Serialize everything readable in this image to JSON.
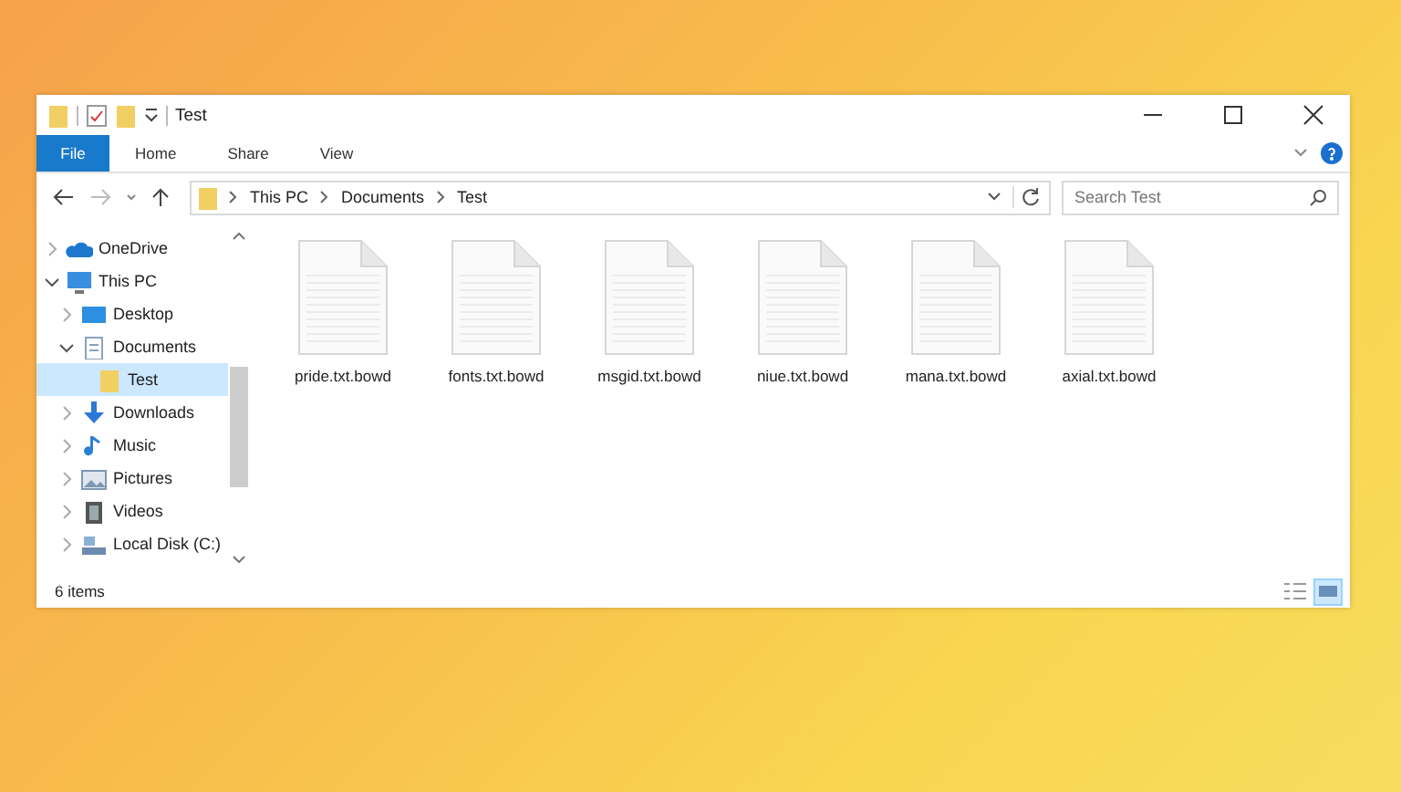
{
  "window": {
    "title": "Test"
  },
  "ribbon_tabs": [
    {
      "label": "File",
      "kind": "file"
    },
    {
      "label": "Home",
      "kind": "tab"
    },
    {
      "label": "Share",
      "kind": "tab"
    },
    {
      "label": "View",
      "kind": "tab"
    }
  ],
  "address_bar": {
    "breadcrumb": [
      "This PC",
      "Documents",
      "Test"
    ]
  },
  "search": {
    "placeholder": "Search Test"
  },
  "nav": {
    "items": [
      {
        "label": "OneDrive",
        "kind": "cloud",
        "expanded": false,
        "selected": false
      },
      {
        "label": "This PC",
        "kind": "pc",
        "expanded": true,
        "selected": false,
        "children": [
          {
            "label": "Desktop",
            "kind": "desktop",
            "expanded": false,
            "selected": false
          },
          {
            "label": "Documents",
            "kind": "documents",
            "expanded": true,
            "selected": false,
            "children": [
              {
                "label": "Test",
                "kind": "folder",
                "selected": true
              }
            ]
          },
          {
            "label": "Downloads",
            "kind": "downloads",
            "expanded": false,
            "selected": false
          },
          {
            "label": "Music",
            "kind": "music",
            "expanded": false,
            "selected": false
          },
          {
            "label": "Pictures",
            "kind": "pictures",
            "expanded": false,
            "selected": false
          },
          {
            "label": "Videos",
            "kind": "videos",
            "expanded": false,
            "selected": false
          },
          {
            "label": "Local Disk (C:)",
            "kind": "disk",
            "expanded": false,
            "selected": false
          }
        ]
      }
    ]
  },
  "files": [
    {
      "name": "pride.txt.bowd"
    },
    {
      "name": "fonts.txt.bowd"
    },
    {
      "name": "msgid.txt.bowd"
    },
    {
      "name": "niue.txt.bowd"
    },
    {
      "name": "mana.txt.bowd"
    },
    {
      "name": "axial.txt.bowd"
    }
  ],
  "status_bar": {
    "count": "6 items",
    "views": [
      {
        "kind": "details",
        "selected": false
      },
      {
        "kind": "large-icons",
        "selected": true
      }
    ]
  }
}
